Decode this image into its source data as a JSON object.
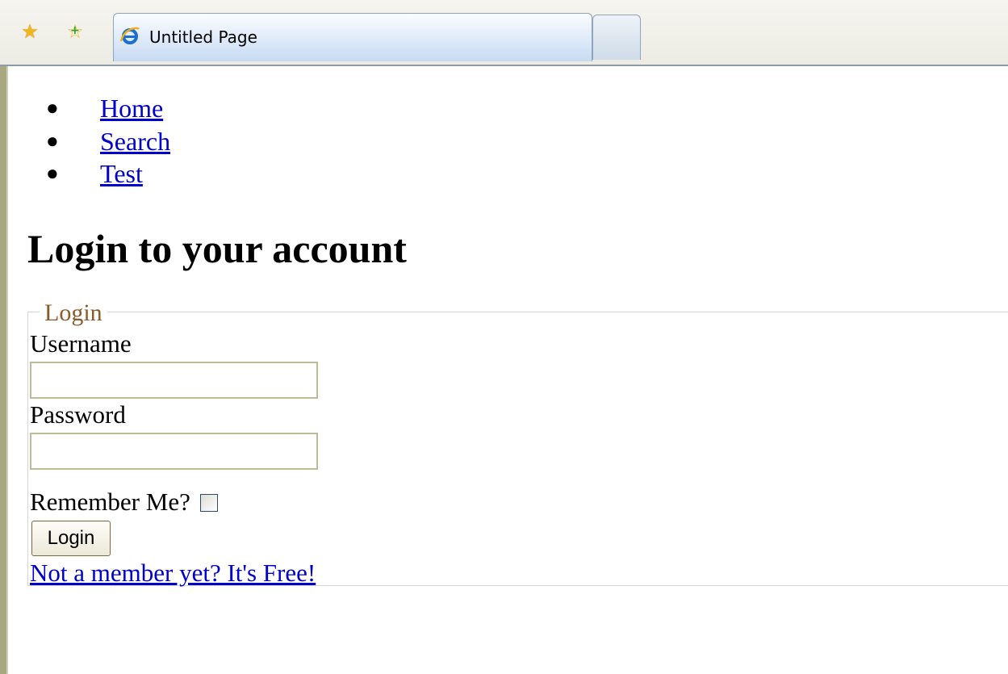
{
  "browser": {
    "tab_title": "Untitled Page",
    "icons": [
      "favorites-star-icon",
      "add-favorite-icon",
      "ie-page-icon",
      "new-tab-icon"
    ]
  },
  "nav": {
    "items": [
      {
        "label": "Home"
      },
      {
        "label": "Search"
      },
      {
        "label": "Test"
      }
    ]
  },
  "page": {
    "title": "Login to your account"
  },
  "login_form": {
    "legend": "Login",
    "username_label": "Username",
    "username_value": "",
    "password_label": "Password",
    "password_value": "",
    "remember_label": "Remember Me?",
    "remember_checked": false,
    "submit_label": "Login",
    "signup_link": "Not a member yet? It's Free!"
  },
  "colors": {
    "link": "#0000cc",
    "legend": "#8b5a2b",
    "tab_active": "#dbe8f8"
  }
}
